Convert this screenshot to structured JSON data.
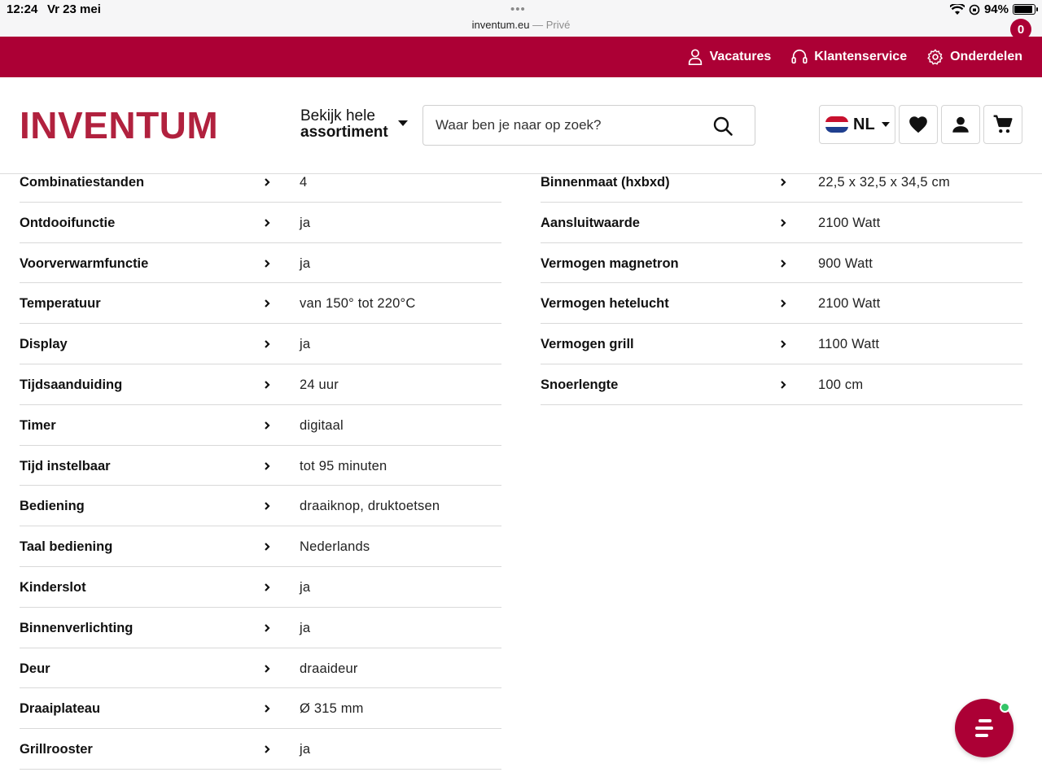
{
  "status_bar": {
    "time": "12:24",
    "date": "Vr 23 mei",
    "dots": "•••",
    "url": "inventum.eu",
    "private_label": " — Privé",
    "battery": "94%",
    "battery_level": 0.94
  },
  "topbar": {
    "links": [
      {
        "label": "Vacatures",
        "icon": "person-icon"
      },
      {
        "label": "Klantenservice",
        "icon": "headset-icon"
      },
      {
        "label": "Onderdelen",
        "icon": "gear-icon"
      }
    ],
    "color": "#ac0035"
  },
  "header": {
    "logo": "INVENTUM",
    "assortment_line1": "Bekijk hele",
    "assortment_line2": "assortiment",
    "search_placeholder": "Waar ben je naar op zoek?",
    "language": "NL",
    "cart_count": "0",
    "brand_color": "#b1213e"
  },
  "specs_left": [
    {
      "label": "Combinatiestanden",
      "value": "4"
    },
    {
      "label": "Ontdooifunctie",
      "value": "ja"
    },
    {
      "label": "Voorverwarmfunctie",
      "value": "ja"
    },
    {
      "label": "Temperatuur",
      "value": "van 150° tot 220°C"
    },
    {
      "label": "Display",
      "value": "ja"
    },
    {
      "label": "Tijdsaanduiding",
      "value": "24 uur"
    },
    {
      "label": "Timer",
      "value": "digitaal"
    },
    {
      "label": "Tijd instelbaar",
      "value": "tot 95 minuten"
    },
    {
      "label": "Bediening",
      "value": "draaiknop, druktoetsen"
    },
    {
      "label": "Taal bediening",
      "value": "Nederlands"
    },
    {
      "label": "Kinderslot",
      "value": "ja"
    },
    {
      "label": "Binnenverlichting",
      "value": "ja"
    },
    {
      "label": "Deur",
      "value": "draaideur"
    },
    {
      "label": "Draaiplateau",
      "value": "Ø 315 mm"
    },
    {
      "label": "Grillrooster",
      "value": "ja"
    }
  ],
  "specs_right": [
    {
      "label": "Binnenmaat (hxbxd)",
      "value": "22,5 x 32,5 x 34,5 cm"
    },
    {
      "label": "Aansluitwaarde",
      "value": "2100 Watt"
    },
    {
      "label": "Vermogen magnetron",
      "value": "900 Watt"
    },
    {
      "label": "Vermogen hetelucht",
      "value": "2100 Watt"
    },
    {
      "label": "Vermogen grill",
      "value": "1100 Watt"
    },
    {
      "label": "Snoerlengte",
      "value": "100 cm"
    }
  ]
}
